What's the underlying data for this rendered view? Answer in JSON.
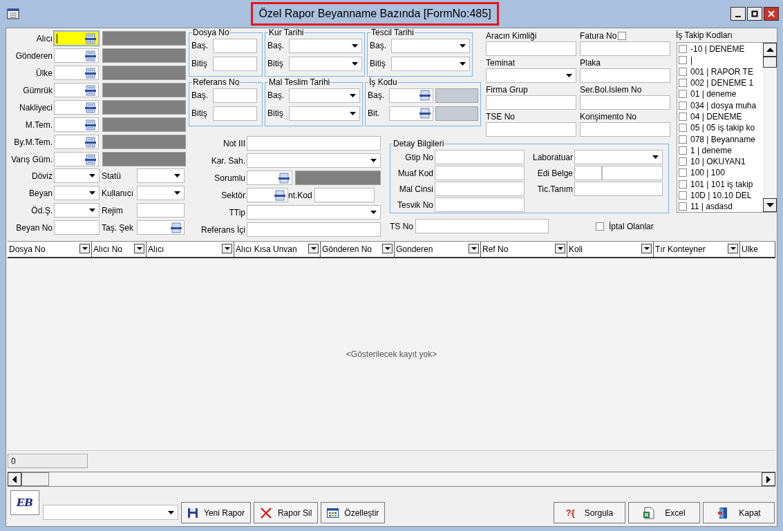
{
  "window": {
    "title": "Özel Rapor Beyanname Bazında [FormNo:485]",
    "highlighted": true
  },
  "lookups": [
    {
      "label": "Alıcı",
      "focused": true
    },
    {
      "label": "Gönderen",
      "focused": false
    },
    {
      "label": "Ülke",
      "focused": false
    },
    {
      "label": "Gümrük",
      "focused": false
    },
    {
      "label": "Nakliyeci",
      "focused": false
    },
    {
      "label": "M.Tem.",
      "focused": false
    },
    {
      "label": "By.M.Tem.",
      "focused": false
    },
    {
      "label": "Varış Güm.",
      "focused": false
    }
  ],
  "options": [
    {
      "label": "Döviz",
      "kind": "dropdown"
    },
    {
      "label": "Statü",
      "kind": "dropdown"
    },
    {
      "label": "Beyan",
      "kind": "dropdown"
    },
    {
      "label": "Kullanıcı",
      "kind": "dropdown"
    },
    {
      "label": "Öd.Ş.",
      "kind": "dropdown"
    },
    {
      "label": "Rejim",
      "kind": "text"
    },
    {
      "label": "Beyan No",
      "kind": "text"
    },
    {
      "label": "Taş. Şek",
      "kind": "lookup"
    }
  ],
  "ranges": [
    {
      "title": "Dosya No",
      "kind": "text",
      "from": "Baş.",
      "to": "Bitiş"
    },
    {
      "title": "Kur Tarihi",
      "kind": "date",
      "from": "Baş.",
      "to": "Bitiş"
    },
    {
      "title": "Tescil Tarihi",
      "kind": "date",
      "from": "Baş.",
      "to": "Bitiş"
    },
    {
      "title": "Referans No",
      "kind": "text",
      "from": "Baş.",
      "to": "Bitiş"
    },
    {
      "title": "Mal Teslim Tarihi",
      "kind": "date",
      "from": "Baş.",
      "to": "Bitiş"
    },
    {
      "title": "İş Kodu",
      "kind": "lookup",
      "from": "Baş.",
      "to": "Bit."
    }
  ],
  "fields": [
    {
      "label": "Not III",
      "kind": "text"
    },
    {
      "label": "Kar. Sah.",
      "kind": "dropdown"
    },
    {
      "label": "Sorumlu",
      "kind": "lookup_name"
    },
    {
      "label": "Sektör",
      "kind": "lookup_code",
      "extra_label": "nt.Kod"
    },
    {
      "label": "TTip",
      "kind": "dropdown"
    },
    {
      "label": "Referans İçi",
      "kind": "text"
    }
  ],
  "vehicle_fields": [
    {
      "label": "Aracın Kimliği",
      "kind": "text"
    },
    {
      "label": "Fatura No",
      "kind": "checkbox_text",
      "checked": false
    },
    {
      "label": "Teminat",
      "kind": "dropdown"
    },
    {
      "label": "Plaka",
      "kind": "text"
    },
    {
      "label": "Firma Grup",
      "kind": "text"
    },
    {
      "label": "Ser.Bol.Islem No",
      "kind": "text"
    },
    {
      "label": "TSE No",
      "kind": "text"
    },
    {
      "label": "Konşimento No",
      "kind": "text"
    }
  ],
  "detail": {
    "title": "Detay Bilgileri",
    "left": [
      "Gtip No",
      "Muaf Kod",
      "Mal Cinsi",
      "Tesvik No"
    ],
    "right": [
      {
        "label": "Laboratuar",
        "kind": "dropdown"
      },
      {
        "label": "Edi Belge",
        "kind": "split"
      },
      {
        "label": "Tic.Tanım",
        "kind": "text"
      }
    ]
  },
  "ts_no": {
    "label": "TS No"
  },
  "cancelled_filter": {
    "label": "İptal Olanlar",
    "checked": false
  },
  "tracking_codes": {
    "title": "İş Takip Kodları",
    "items": [
      {
        "label": "-10 | DENEME",
        "checked": false
      },
      {
        "label": "|",
        "checked": false
      },
      {
        "label": "001 | RAPOR TE",
        "checked": false
      },
      {
        "label": "002 | DENEME 1",
        "checked": false
      },
      {
        "label": "01 | deneme",
        "checked": false
      },
      {
        "label": "034 | dosya muha",
        "checked": false
      },
      {
        "label": "04 | DENEME",
        "checked": false
      },
      {
        "label": "05 | 05 iş takip ko",
        "checked": false
      },
      {
        "label": "078 | Beyanname",
        "checked": false
      },
      {
        "label": "1 | deneme",
        "checked": false
      },
      {
        "label": "10 | OKUYAN1",
        "checked": false
      },
      {
        "label": "100 | 100",
        "checked": false
      },
      {
        "label": "101 | 101 iş takip",
        "checked": false
      },
      {
        "label": "10D | 10.10 DEL",
        "checked": false
      },
      {
        "label": "11 | asdasd",
        "checked": false
      }
    ]
  },
  "grid": {
    "columns": [
      {
        "label": "Dosya No",
        "filter": true
      },
      {
        "label": "Alıcı No",
        "filter": true
      },
      {
        "label": "Alıcı",
        "filter": true
      },
      {
        "label": "Alıcı Kısa Unvan",
        "filter": true
      },
      {
        "label": "Gönderen No",
        "filter": true
      },
      {
        "label": "Gonderen",
        "filter": true
      },
      {
        "label": "Ref No",
        "filter": true
      },
      {
        "label": "Koli",
        "filter": true
      },
      {
        "label": "Tır Konteyner",
        "filter": true
      },
      {
        "label": "Ulke",
        "filter": false
      }
    ],
    "empty_text": "<Gösterilecek kayıt yok>",
    "count": "0"
  },
  "toolbar": {
    "logo": "EB",
    "left_buttons": [
      {
        "label": "Yeni Rapor"
      },
      {
        "label": "Rapor Sil"
      },
      {
        "label": "Özelleştir"
      }
    ],
    "right_buttons": [
      {
        "label": "Sorgula",
        "icon_text": "?{"
      },
      {
        "label": "Excel"
      },
      {
        "label": "Kapat"
      }
    ]
  }
}
